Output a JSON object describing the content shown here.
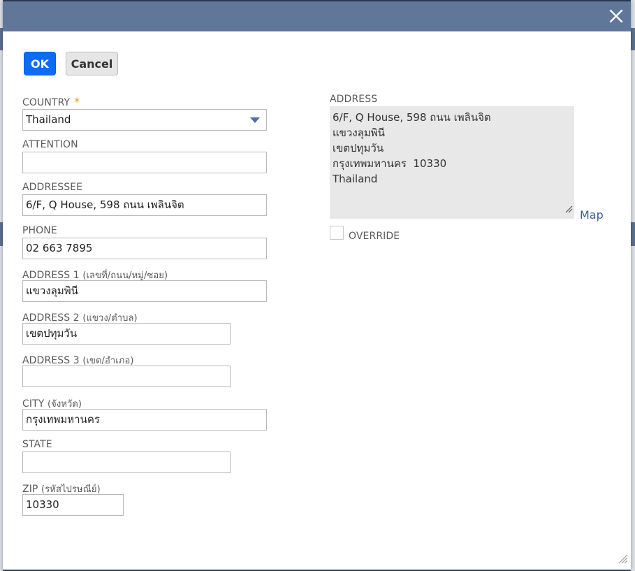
{
  "dialog": {
    "close_icon": "close-icon"
  },
  "buttons": {
    "ok": "OK",
    "cancel": "Cancel"
  },
  "form": {
    "country": {
      "label": "COUNTRY",
      "required_mark": "*",
      "value": "Thailand"
    },
    "attention": {
      "label": "ATTENTION",
      "value": ""
    },
    "addressee": {
      "label": "ADDRESSEE",
      "value": "6/F, Q House, 598 ถนน เพลินจิต"
    },
    "phone": {
      "label": "PHONE",
      "value": "02 663 7895"
    },
    "address1": {
      "label": "ADDRESS 1",
      "sub": "(เลขที่/ถนน/หมู่/ซอย)",
      "value": "แขวงลุมพินี"
    },
    "address2": {
      "label": "ADDRESS 2",
      "sub": "(แขวง/ตำบล)",
      "value": "เขตปทุมวัน"
    },
    "address3": {
      "label": "ADDRESS 3",
      "sub": "(เขต/อำเภอ)",
      "value": ""
    },
    "city": {
      "label": "CITY",
      "sub": "(จังหวัด)",
      "value": "กรุงเทพมหานคร"
    },
    "state": {
      "label": "STATE",
      "value": ""
    },
    "zip": {
      "label": "ZIP",
      "sub": "(รหัสไปรษณีย์)",
      "value": "10330"
    }
  },
  "address_panel": {
    "label": "ADDRESS",
    "lines": [
      "6/F, Q House, 598 ถนน เพลินจิต",
      "แขวงลุมพินี",
      "เขตปทุมวัน",
      "กรุงเทพมหานคร  10330",
      "Thailand"
    ],
    "map_link": "Map",
    "override_label": "OVERRIDE"
  },
  "colors": {
    "titlebar": "#607799",
    "ok_button": "#0b6cf5",
    "required": "#e0a000",
    "link": "#3b5e96"
  }
}
